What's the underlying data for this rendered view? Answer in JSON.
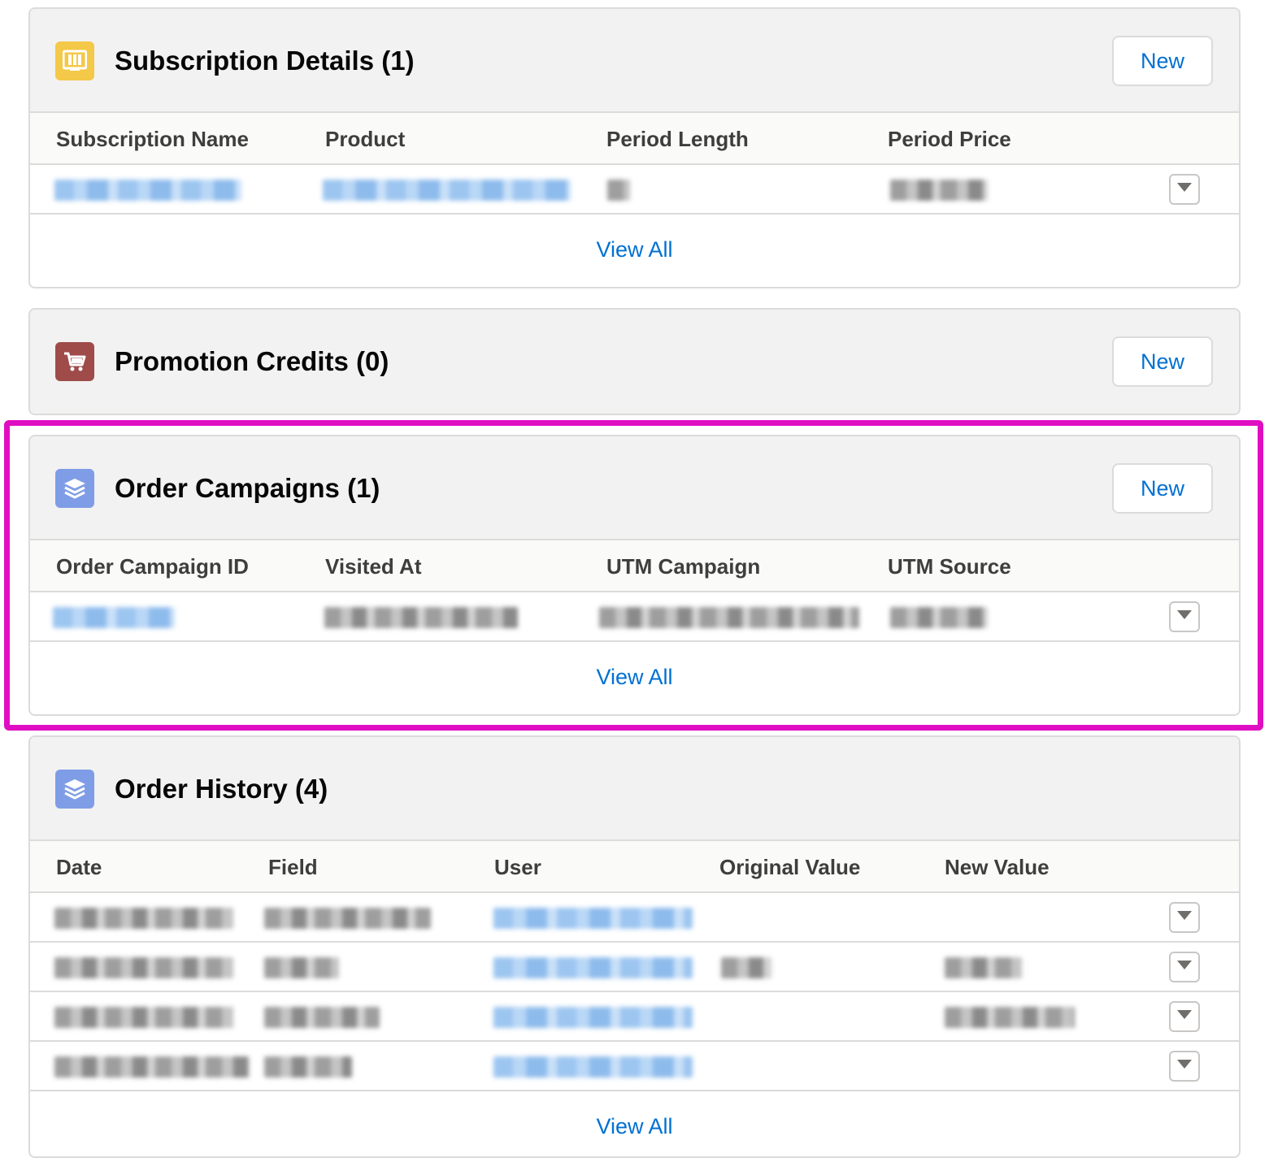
{
  "subscription_details": {
    "title": "Subscription Details (1)",
    "icon": "subscription-icon",
    "icon_color": "#f4c848",
    "new_label": "New",
    "columns": [
      "Subscription Name",
      "Product",
      "Period Length",
      "Period Price"
    ],
    "view_all": "View All"
  },
  "promotion_credits": {
    "title": "Promotion Credits (0)",
    "icon": "cart-icon",
    "icon_color": "#9e4b4a",
    "new_label": "New"
  },
  "order_campaigns": {
    "title": "Order Campaigns (1)",
    "icon": "layers-icon",
    "icon_color": "#7f9de6",
    "new_label": "New",
    "columns": [
      "Order Campaign ID",
      "Visited At",
      "UTM Campaign",
      "UTM Source"
    ],
    "view_all": "View All"
  },
  "order_history": {
    "title": "Order History (4)",
    "icon": "layers-icon",
    "icon_color": "#7f9de6",
    "columns": [
      "Date",
      "Field",
      "User",
      "Original Value",
      "New Value"
    ],
    "view_all": "View All"
  },
  "colors": {
    "link": "#0070d2",
    "highlight": "#e00ec2",
    "header_bg": "#f3f2f2"
  }
}
